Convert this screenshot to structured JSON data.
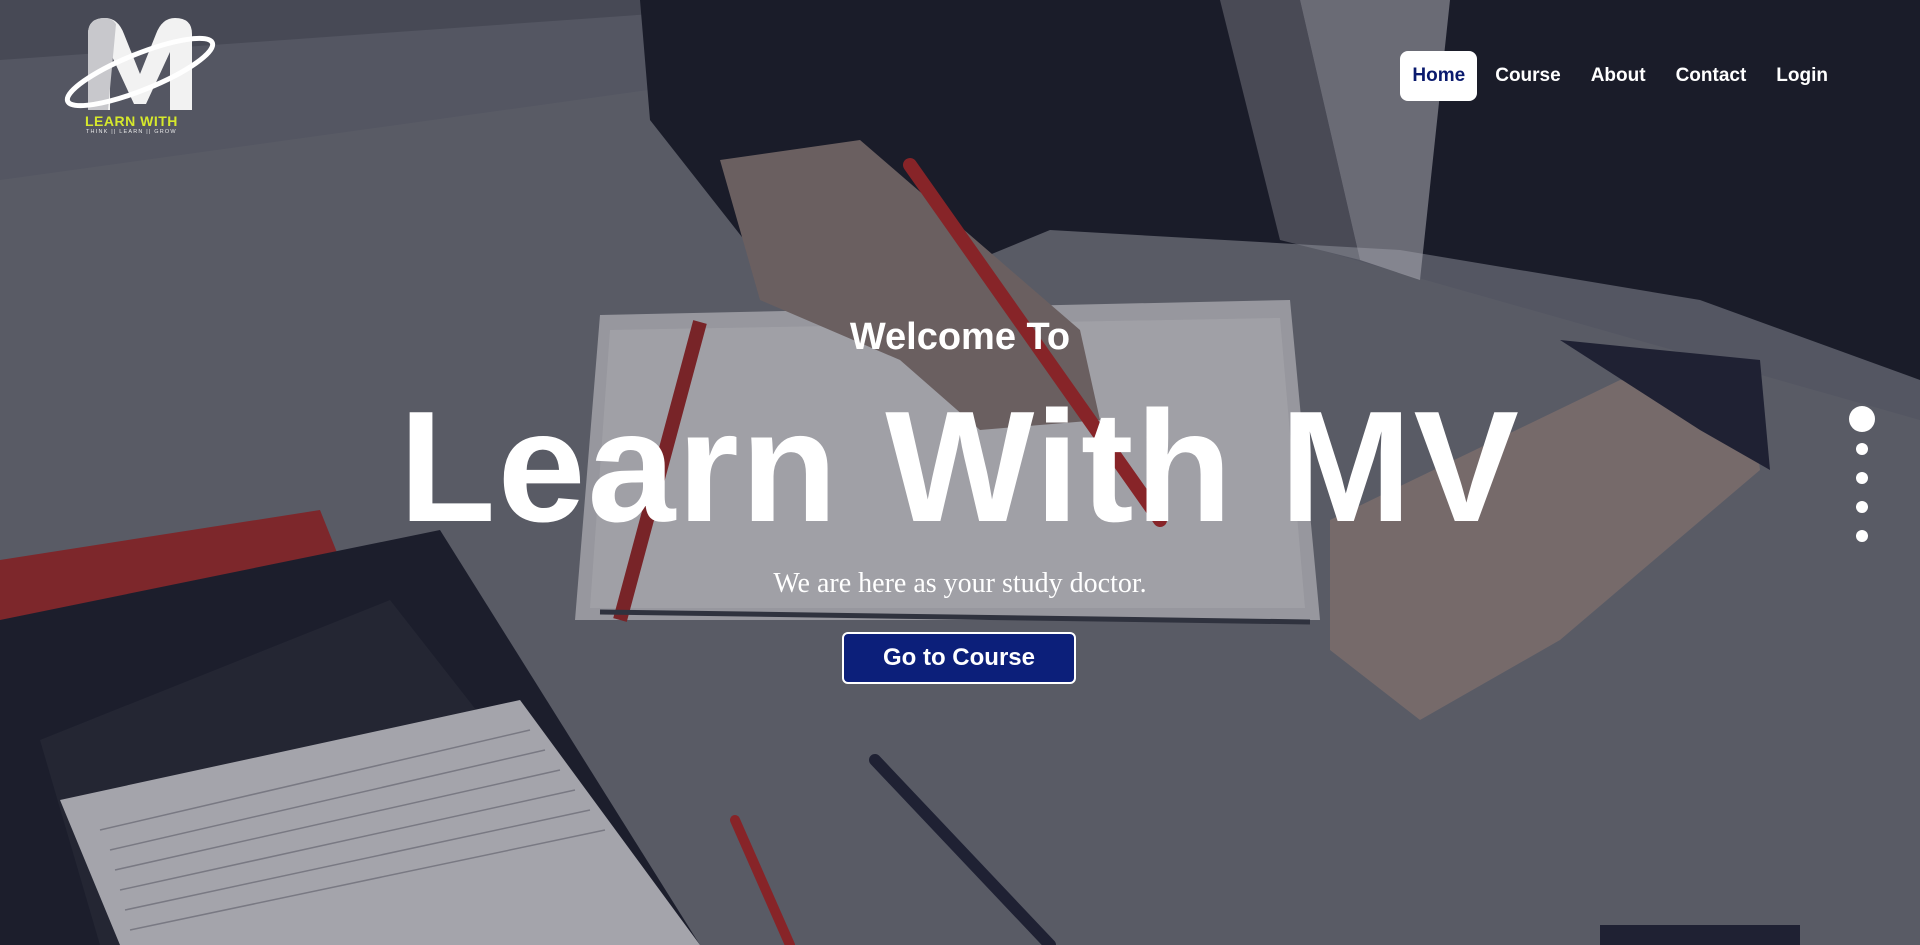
{
  "brand": {
    "logo_text": "LEARN WITH",
    "logo_tagline": "THINK || LEARN || GROW",
    "logo_accent_color": "#d6e82c"
  },
  "nav": {
    "items": [
      {
        "label": "Home",
        "active": true
      },
      {
        "label": "Course",
        "active": false
      },
      {
        "label": "About",
        "active": false
      },
      {
        "label": "Contact",
        "active": false
      },
      {
        "label": "Login",
        "active": false
      }
    ],
    "active_color": "#0a1a6e"
  },
  "hero": {
    "welcome": "Welcome To",
    "headline": "Learn With MV",
    "tagline": "We are here as your study doctor.",
    "cta_label": "Go to Course",
    "cta_color": "#0c1f7a"
  },
  "slider": {
    "dot_count": 5,
    "active_index": 0
  }
}
